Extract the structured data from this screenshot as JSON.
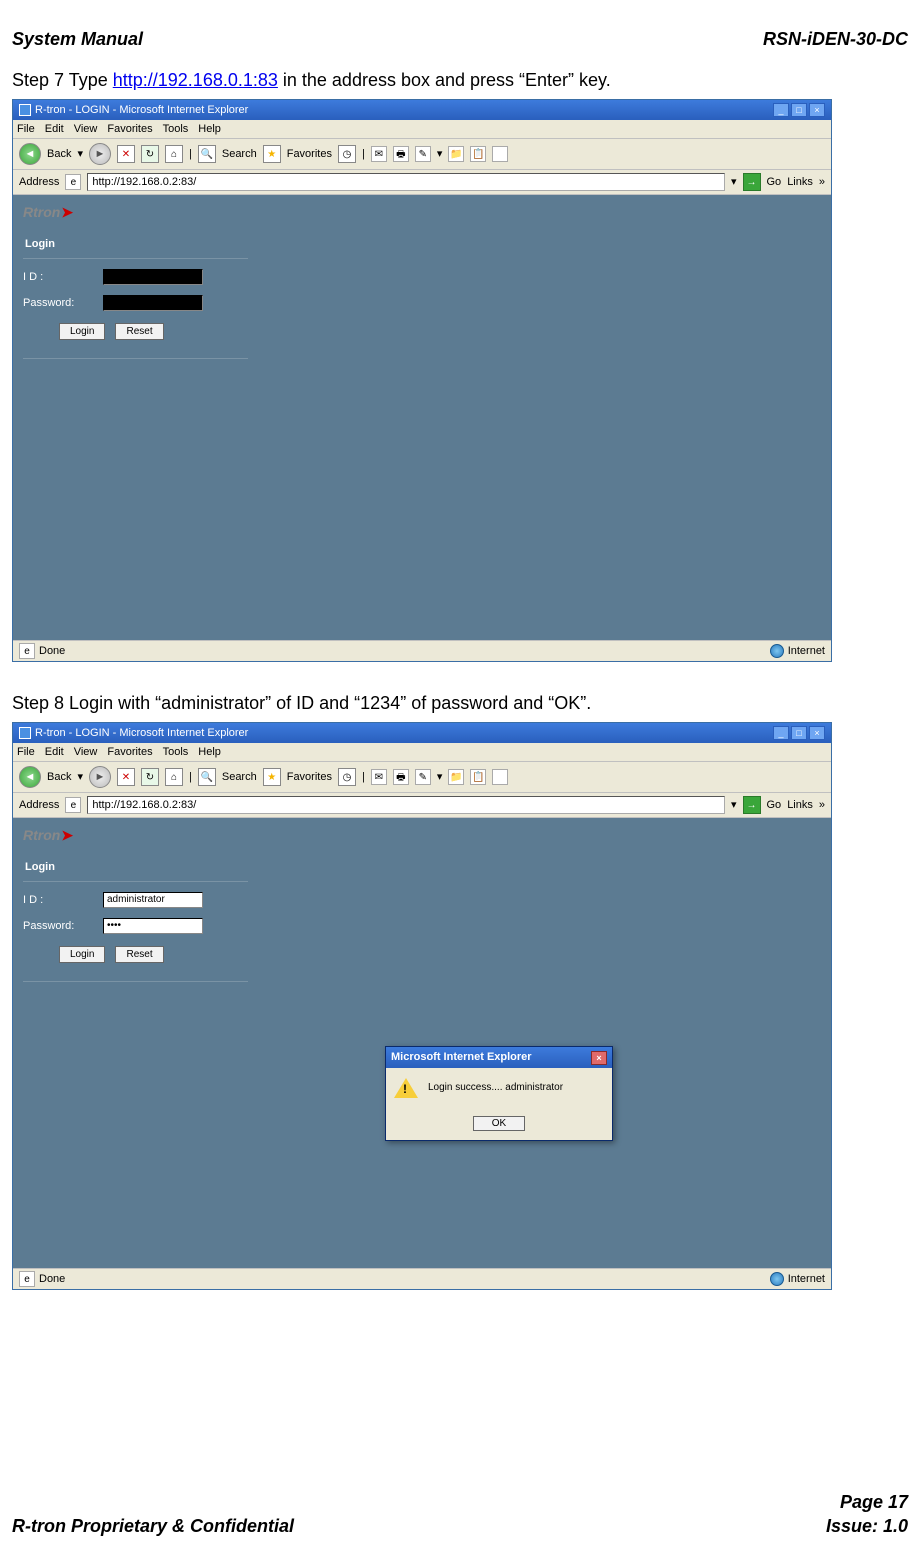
{
  "header": {
    "left": "System Manual",
    "right": "RSN-iDEN-30-DC"
  },
  "step7": {
    "prefix": "Step 7 Type ",
    "url": "http://192.168.0.1:83",
    "suffix": " in the address box and press “Enter” key."
  },
  "ie1": {
    "title": "R-tron - LOGIN - Microsoft Internet Explorer",
    "menubar": [
      "File",
      "Edit",
      "View",
      "Favorites",
      "Tools",
      "Help"
    ],
    "toolbar": {
      "back": "Back",
      "search": "Search",
      "favorites": "Favorites"
    },
    "addrbar": {
      "label": "Address",
      "url": "http://192.168.0.2:83/",
      "go": "Go",
      "links": "Links"
    },
    "logo": {
      "text": "Rtron"
    },
    "login": {
      "title": "Login",
      "id_label": "I D :",
      "pw_label": "Password:",
      "id_value": "",
      "pw_value": "",
      "login_btn": "Login",
      "reset_btn": "Reset"
    },
    "status": {
      "left": "Done",
      "right": "Internet"
    }
  },
  "step8": {
    "text": "Step 8 Login with “administrator” of ID and “1234” of password and “OK”."
  },
  "ie2": {
    "title": "R-tron - LOGIN - Microsoft Internet Explorer",
    "menubar": [
      "File",
      "Edit",
      "View",
      "Favorites",
      "Tools",
      "Help"
    ],
    "toolbar": {
      "back": "Back",
      "search": "Search",
      "favorites": "Favorites"
    },
    "addrbar": {
      "label": "Address",
      "url": "http://192.168.0.2:83/",
      "go": "Go",
      "links": "Links"
    },
    "logo": {
      "text": "Rtron"
    },
    "login": {
      "title": "Login",
      "id_label": "I D :",
      "pw_label": "Password:",
      "id_value": "administrator",
      "pw_value": "••••",
      "login_btn": "Login",
      "reset_btn": "Reset"
    },
    "msgbox": {
      "title": "Microsoft Internet Explorer",
      "text": "Login success.... administrator",
      "ok": "OK"
    },
    "status": {
      "left": "Done",
      "right": "Internet"
    }
  },
  "footer": {
    "left": "R-tron Proprietary & Confidential",
    "right_page": "Page 17",
    "right_issue": "Issue: 1.0"
  }
}
